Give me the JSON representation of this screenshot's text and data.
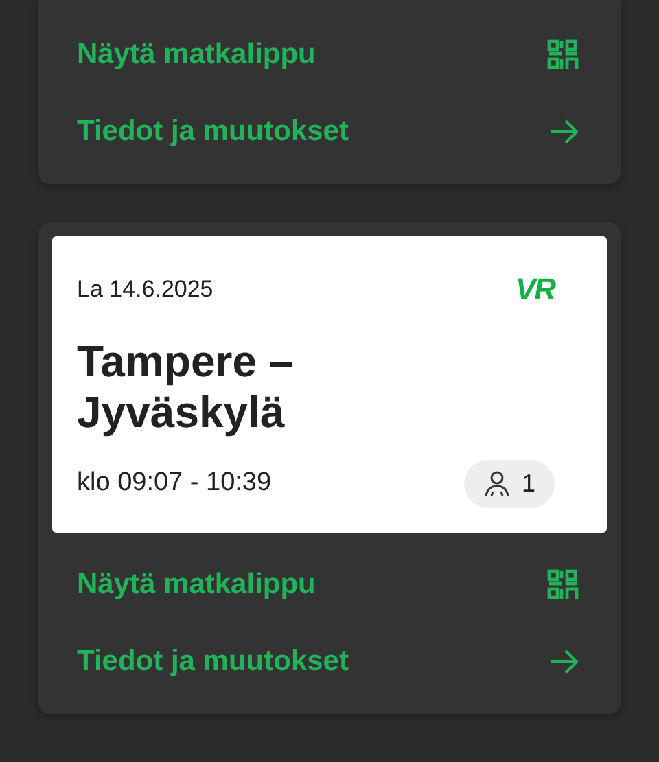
{
  "bookings": [
    {
      "actions": [
        {
          "label": "Näytä matkalippu",
          "kind": "qr"
        },
        {
          "label": "Tiedot ja muutokset",
          "kind": "arrow"
        }
      ]
    },
    {
      "ticket": {
        "date": "La 14.6.2025",
        "logo": "VR",
        "route": "Tampere – Jyväskylä",
        "time": "klo 09:07 - 10:39",
        "passengers": "1"
      },
      "actions": [
        {
          "label": "Näytä matkalippu",
          "kind": "qr"
        },
        {
          "label": "Tiedot ja muutokset",
          "kind": "arrow"
        }
      ]
    }
  ]
}
